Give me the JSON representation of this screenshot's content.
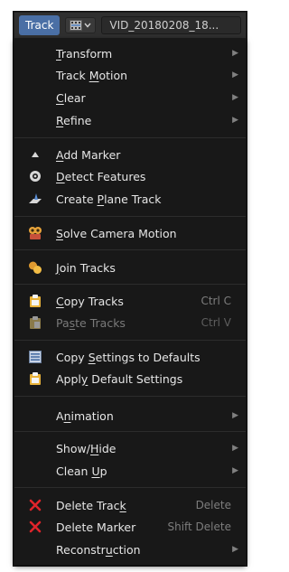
{
  "header": {
    "menu_label": "Track",
    "clip_name": "VID_20180208_18..."
  },
  "menu": {
    "transform": {
      "pre": "",
      "u": "T",
      "post": "ransform"
    },
    "track_motion": {
      "pre": "Track ",
      "u": "M",
      "post": "otion"
    },
    "clear": {
      "pre": "",
      "u": "C",
      "post": "lear"
    },
    "refine": {
      "pre": "",
      "u": "R",
      "post": "efine"
    },
    "add_marker": {
      "pre": "",
      "u": "A",
      "post": "dd Marker"
    },
    "detect_features": {
      "pre": "",
      "u": "D",
      "post": "etect Features"
    },
    "create_plane_track": {
      "pre": "Create ",
      "u": "P",
      "post": "lane Track"
    },
    "solve_camera_motion": {
      "pre": "",
      "u": "S",
      "post": "olve Camera Motion"
    },
    "join_tracks": {
      "pre": "",
      "u": "J",
      "post": "oin Tracks"
    },
    "copy_tracks": {
      "pre": "",
      "u": "C",
      "post": "opy Tracks",
      "shortcut": "Ctrl C"
    },
    "paste_tracks": {
      "pre": "Pa",
      "u": "s",
      "post": "te Tracks",
      "shortcut": "Ctrl V"
    },
    "copy_settings": {
      "pre": "Copy ",
      "u": "S",
      "post": "ettings to Defaults"
    },
    "apply_defaults": {
      "pre": "Appl",
      "u": "y",
      "post": " Default Settings"
    },
    "animation": {
      "pre": "A",
      "u": "n",
      "post": "imation"
    },
    "show_hide": {
      "pre": "Show/",
      "u": "H",
      "post": "ide"
    },
    "clean_up": {
      "pre": "Clean ",
      "u": "U",
      "post": "p"
    },
    "delete_track": {
      "pre": "Delete Trac",
      "u": "k",
      "post": "",
      "shortcut": "Delete"
    },
    "delete_marker": {
      "pre": "Delete Marker",
      "u": "",
      "post": "",
      "shortcut": "Shift Delete"
    },
    "reconstruction": {
      "pre": "Reconstr",
      "u": "u",
      "post": "ction"
    }
  },
  "icons": {
    "submenu_arrow": "▶",
    "delete_glyph": "✕"
  },
  "colors": {
    "accent": "#4a6fa5",
    "delete_red": "#e0242b",
    "icon_yellow": "#f0b429"
  }
}
